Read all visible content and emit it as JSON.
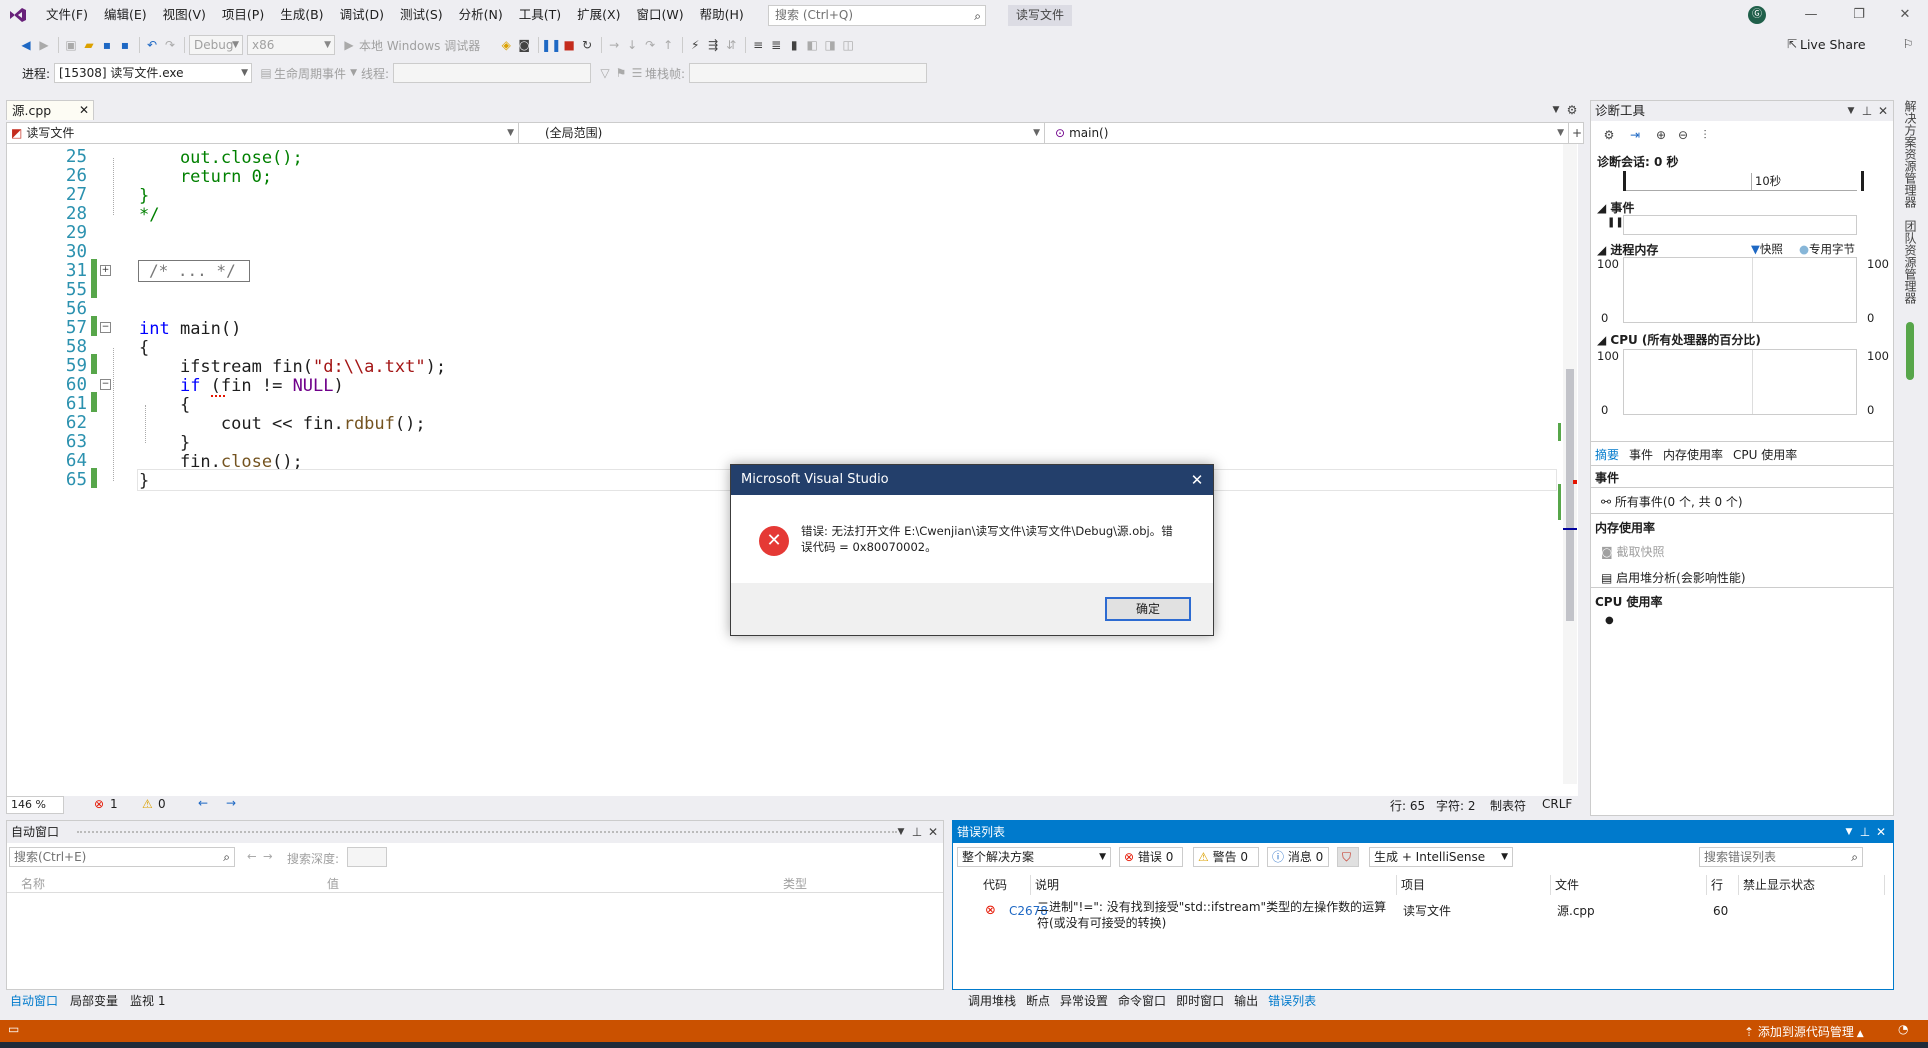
{
  "menu": [
    "文件(F)",
    "编辑(E)",
    "视图(V)",
    "项目(P)",
    "生成(B)",
    "调试(D)",
    "测试(S)",
    "分析(N)",
    "工具(T)",
    "扩展(X)",
    "窗口(W)",
    "帮助(H)"
  ],
  "search": {
    "placeholder": "搜索 (Ctrl+Q)"
  },
  "solution_title": "读写文件",
  "avatar": "Ⓖ",
  "toolbar": {
    "config": "Debug",
    "platform": "x86",
    "debugger": "本地 Windows 调试器",
    "live_share": "Live Share"
  },
  "toolbar2": {
    "process_label": "进程:",
    "process_value": "[15308] 读写文件.exe",
    "lifecycle": "生命周期事件",
    "thread_label": "线程:",
    "stack_label": "堆栈帧:"
  },
  "editor": {
    "tab": "源.cpp",
    "nav_project": "读写文件",
    "nav_scope": "(全局范围)",
    "nav_func": "main()",
    "lines": [
      {
        "n": "25",
        "t": "    out.close();"
      },
      {
        "n": "26",
        "t": "    return 0;"
      },
      {
        "n": "27",
        "t": "}"
      },
      {
        "n": "28",
        "t": "*/"
      },
      {
        "n": "29",
        "t": ""
      },
      {
        "n": "30",
        "t": ""
      },
      {
        "n": "31",
        "t": "/* ... */"
      },
      {
        "n": "55",
        "t": ""
      },
      {
        "n": "56",
        "t": ""
      },
      {
        "n": "57",
        "t": "int main()"
      },
      {
        "n": "58",
        "t": "{"
      },
      {
        "n": "59",
        "t": "    ifstream fin(\"d:\\\\a.txt\");"
      },
      {
        "n": "60",
        "t": "    if (fin != NULL)"
      },
      {
        "n": "61",
        "t": "    {"
      },
      {
        "n": "62",
        "t": "        cout << fin.rdbuf();"
      },
      {
        "n": "63",
        "t": "    }"
      },
      {
        "n": "64",
        "t": "    fin.close();"
      },
      {
        "n": "65",
        "t": "}"
      }
    ],
    "status": {
      "zoom": "146 %",
      "errors": "1",
      "warnings": "0",
      "line": "行: 65",
      "char": "字符: 2",
      "tabs": "制表符",
      "eol": "CRLF"
    }
  },
  "dialog": {
    "title": "Microsoft Visual Studio",
    "message": "错误: 无法打开文件 E:\\Cwenjian\\读写文件\\读写文件\\Debug\\源.obj。错误代码 = 0x80070002。",
    "ok": "确定"
  },
  "diag": {
    "title": "诊断工具",
    "session": "诊断会话: 0 秒",
    "tick": "10秒",
    "events": "事件",
    "mem": "进程内存",
    "snapshot_legend": "快照",
    "private_legend": "专用字节",
    "cpu": "CPU (所有处理器的百分比)",
    "y100": "100",
    "y0": "0",
    "tabs": [
      "摘要",
      "事件",
      "内存使用率",
      "CPU 使用率"
    ],
    "sec_events": "事件",
    "all_events": "所有事件(0 个, 共 0 个)",
    "sec_mem": "内存使用率",
    "take_snapshot": "截取快照",
    "heap_analysis": "启用堆分析(会影响性能)",
    "sec_cpu": "CPU 使用率"
  },
  "side_strip": [
    "解决方案资源管理器",
    "团队资源管理器"
  ],
  "autos": {
    "title": "自动窗口",
    "search": "搜索(Ctrl+E)",
    "depth": "搜索深度:",
    "cols": [
      "名称",
      "值",
      "类型"
    ],
    "tabs": [
      "自动窗口",
      "局部变量",
      "监视 1"
    ]
  },
  "errors": {
    "title": "错误列表",
    "scope": "整个解决方案",
    "err_chip": "错误 0",
    "warn_chip": "警告 0",
    "msg_chip": "消息 0",
    "build": "生成 + IntelliSense",
    "search": "搜索错误列表",
    "cols": [
      "代码",
      "说明",
      "项目",
      "文件",
      "行",
      "禁止显示状态"
    ],
    "row": {
      "code": "C2678",
      "desc": "二进制\"!=\": 没有找到接受\"std::ifstream\"类型的左操作数的运算符(或没有可接受的转换)",
      "project": "读写文件",
      "file": "源.cpp",
      "line": "60"
    },
    "tabs": [
      "调用堆栈",
      "断点",
      "异常设置",
      "命令窗口",
      "即时窗口",
      "输出",
      "错误列表"
    ]
  },
  "statusbar": {
    "source_control": "添加到源代码管理"
  },
  "colors": {
    "accent": "#007acc",
    "status": "#ca5100",
    "dialog_title": "#233f6b",
    "error": "#e53935"
  }
}
